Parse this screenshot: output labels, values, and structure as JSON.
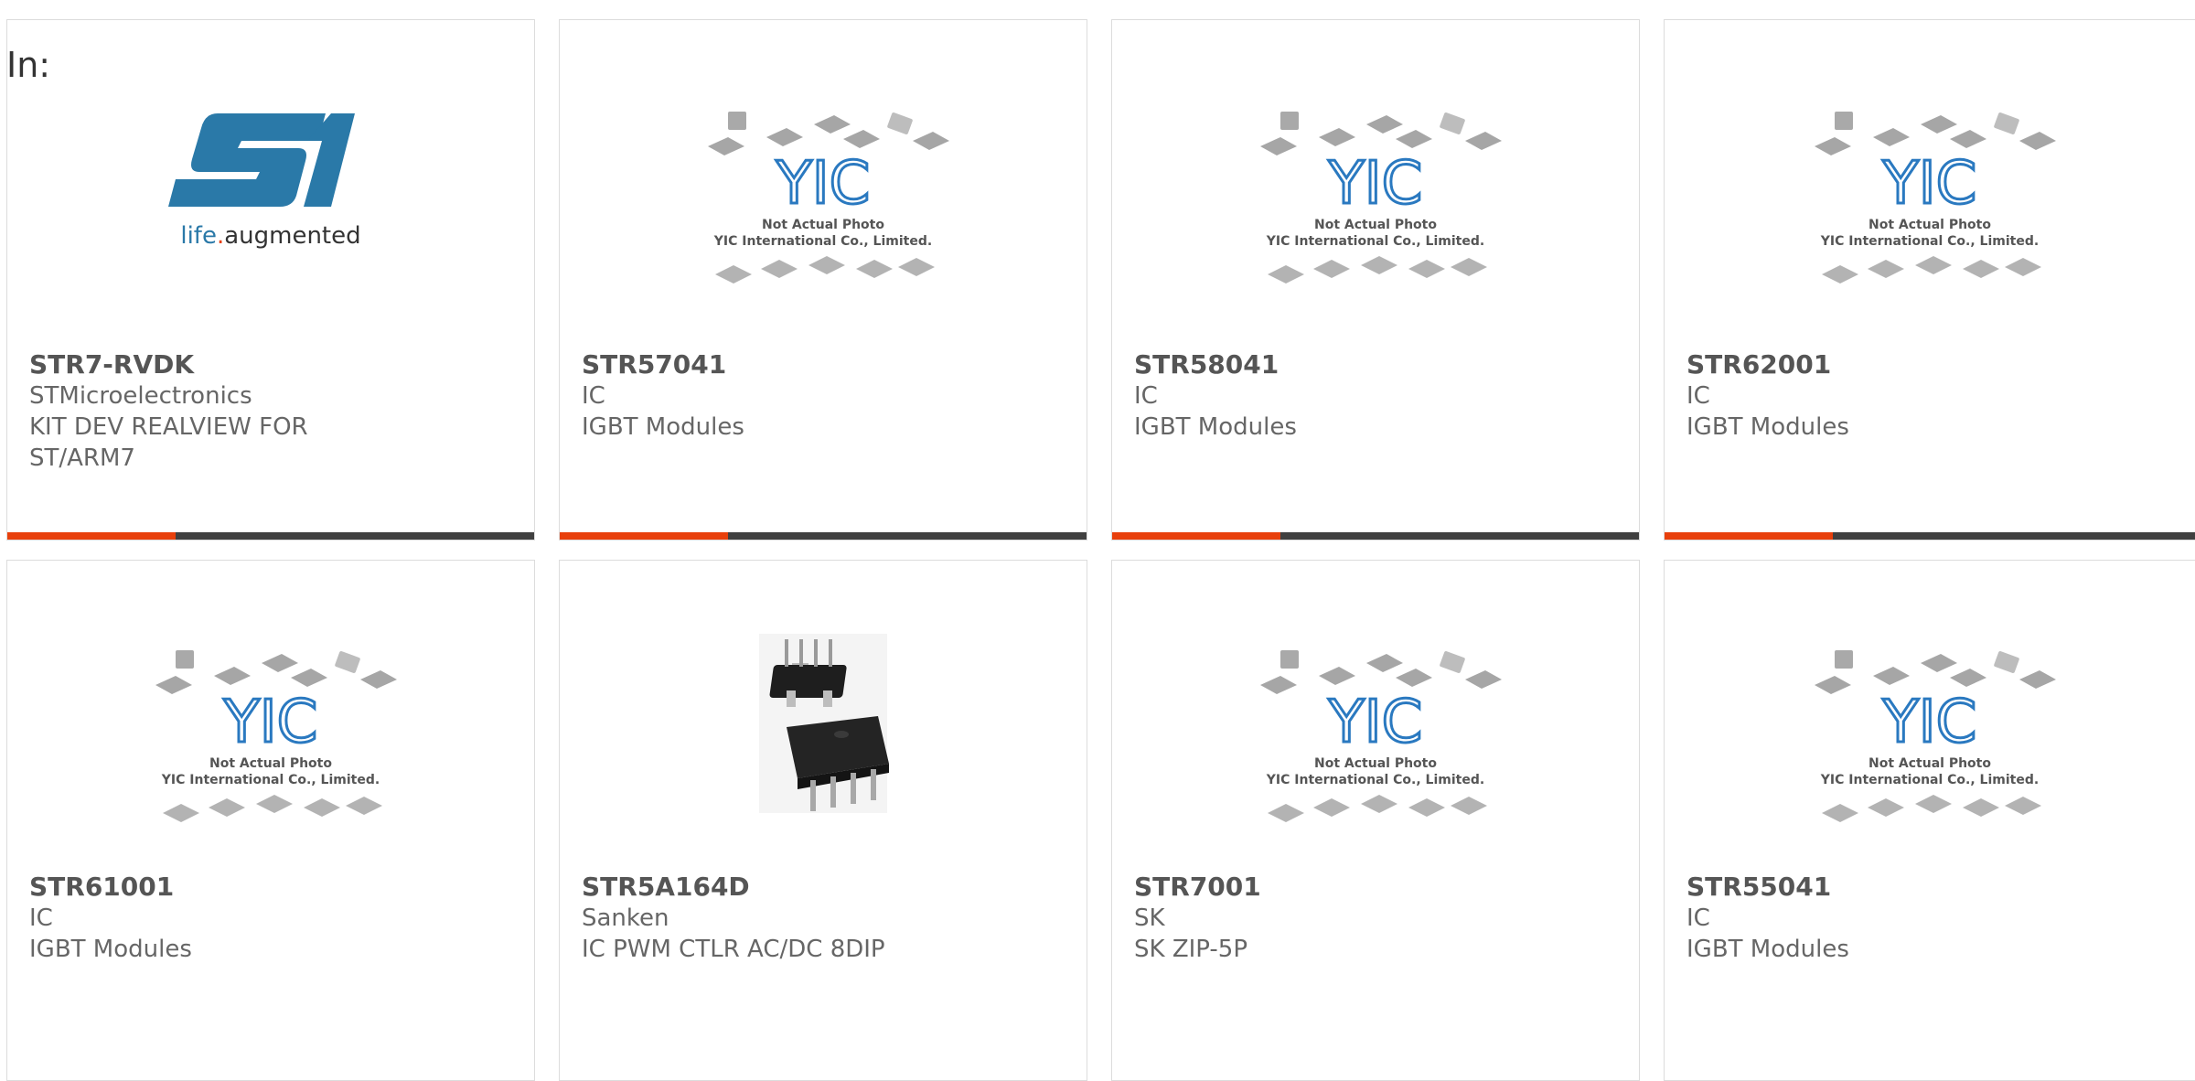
{
  "heading": "In:",
  "colors": {
    "accent": "#e8400c",
    "bar": "#404040",
    "st_logo": "#1b6fa0"
  },
  "placeholder_image": {
    "line1": "Not Actual Photo",
    "line2": "YIC International Co., Limited.",
    "logo_text": "YIC"
  },
  "st_logo": {
    "tagline_life": "life",
    "tagline_dot": ".",
    "tagline_augmented": "augmented"
  },
  "products": [
    {
      "part": "STR7-RVDK",
      "line1": "STMicroelectronics",
      "line2": "KIT DEV REALVIEW FOR",
      "line3": "ST/ARM7",
      "image": "st-logo"
    },
    {
      "part": "STR57041",
      "line1": "IC",
      "line2": "IGBT Modules",
      "image": "yic-placeholder"
    },
    {
      "part": "STR58041",
      "line1": "IC",
      "line2": "IGBT Modules",
      "image": "yic-placeholder"
    },
    {
      "part": "STR62001",
      "line1": "IC",
      "line2": "IGBT Modules",
      "image": "yic-placeholder"
    },
    {
      "part": "STR61001",
      "line1": "IC",
      "line2": "IGBT Modules",
      "image": "yic-placeholder"
    },
    {
      "part": "STR5A164D",
      "line1": "Sanken",
      "line2": "IC PWM CTLR AC/DC 8DIP",
      "image": "dip-package"
    },
    {
      "part": "STR7001",
      "line1": "SK",
      "line2": "SK ZIP-5P",
      "image": "yic-placeholder"
    },
    {
      "part": "STR55041",
      "line1": "IC",
      "line2": "IGBT Modules",
      "image": "yic-placeholder"
    }
  ]
}
